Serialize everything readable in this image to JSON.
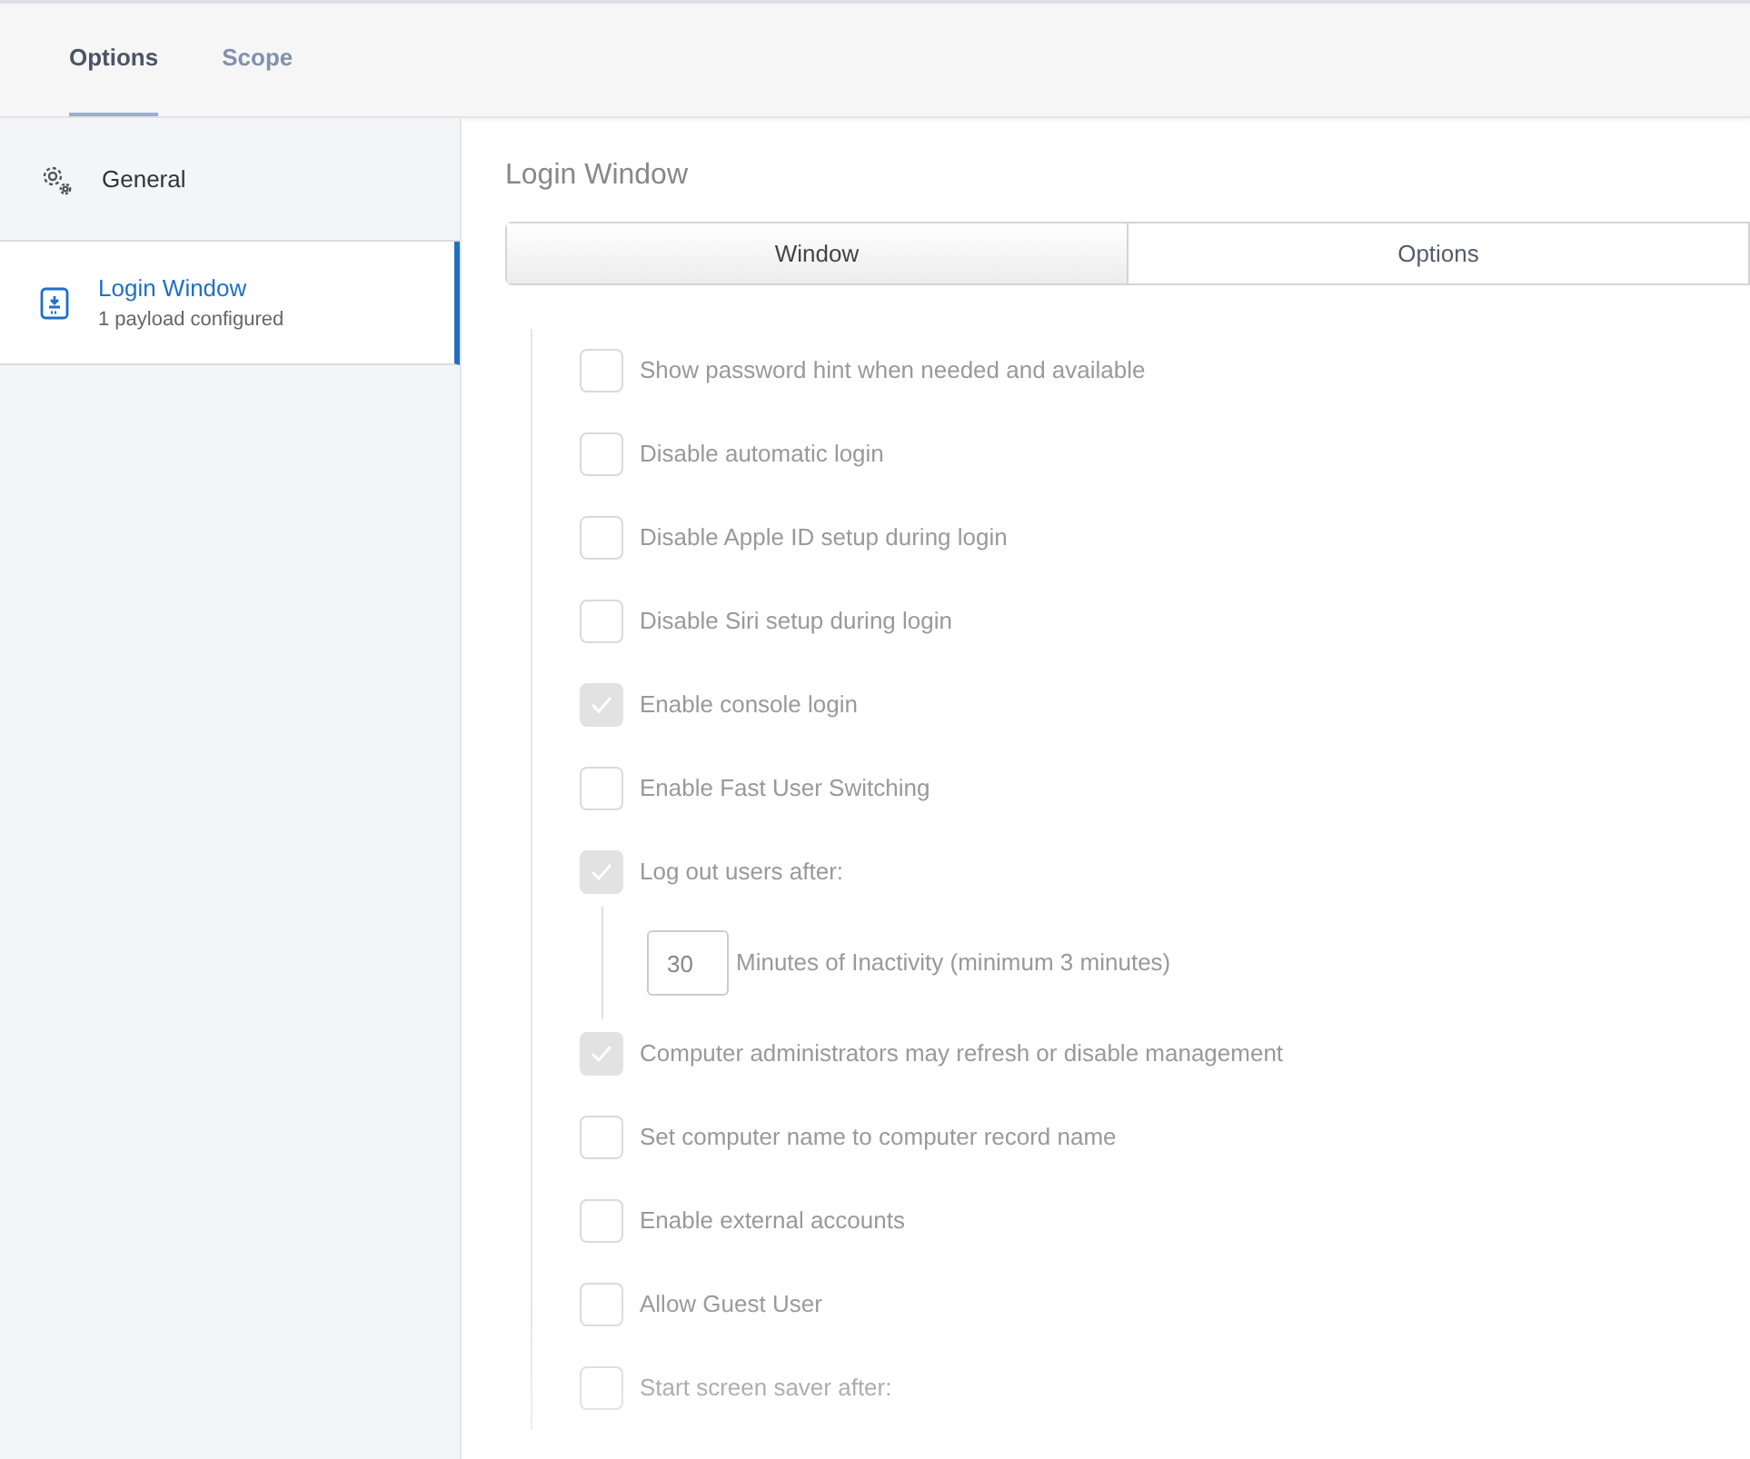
{
  "top_tabs": [
    {
      "label": "Options",
      "selected": true
    },
    {
      "label": "Scope",
      "selected": false
    }
  ],
  "sidebar": {
    "items": [
      {
        "label": "General",
        "selected": false
      },
      {
        "label": "Login Window",
        "subtitle": "1 payload configured",
        "selected": true
      }
    ]
  },
  "content": {
    "title": "Login Window",
    "segments": [
      {
        "label": "Window",
        "selected": true
      },
      {
        "label": "Options",
        "selected": false
      }
    ],
    "options": [
      {
        "kind": "checkbox",
        "label": "Show password hint when needed and available",
        "checked": false
      },
      {
        "kind": "checkbox",
        "label": "Disable automatic login",
        "checked": false
      },
      {
        "kind": "checkbox",
        "label": "Disable Apple ID setup during login",
        "checked": false
      },
      {
        "kind": "checkbox",
        "label": "Disable Siri setup during login",
        "checked": false
      },
      {
        "kind": "checkbox",
        "label": "Enable console login",
        "checked": true
      },
      {
        "kind": "checkbox",
        "label": "Enable Fast User Switching",
        "checked": false
      },
      {
        "kind": "checkbox",
        "label": "Log out users after:",
        "checked": true
      },
      {
        "kind": "number",
        "value": "30",
        "label": "Minutes of Inactivity (minimum 3 minutes)"
      },
      {
        "kind": "checkbox",
        "label": "Computer administrators may refresh or disable management",
        "checked": true
      },
      {
        "kind": "checkbox",
        "label": "Set computer name to computer record name",
        "checked": false
      },
      {
        "kind": "checkbox",
        "label": "Enable external accounts",
        "checked": false
      },
      {
        "kind": "checkbox",
        "label": "Allow Guest User",
        "checked": false
      },
      {
        "kind": "checkbox",
        "label": "Start screen saver after:",
        "checked": false
      }
    ]
  }
}
